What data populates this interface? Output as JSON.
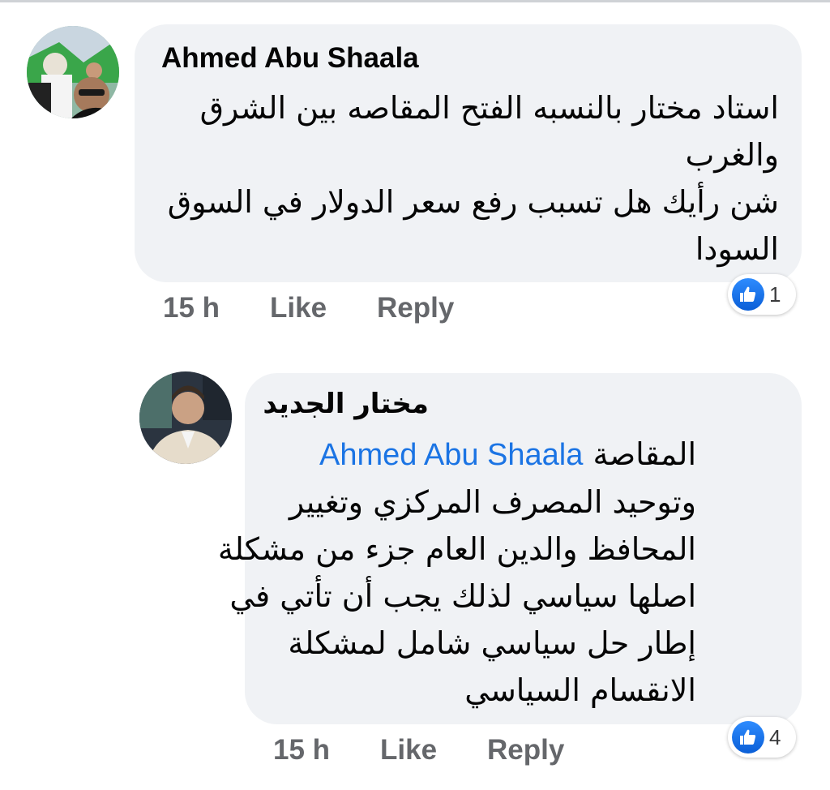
{
  "comments": [
    {
      "author": "Ahmed Abu Shaala",
      "body_lines": [
        "استاد مختار بالنسبه الفتح المقاصه بين الشرق",
        "والغرب",
        "شن رأيك هل تسبب رفع سعر الدولار في السوق",
        "السودا"
      ],
      "time": "15 h",
      "like_label": "Like",
      "reply_label": "Reply",
      "reaction_icon": "like-icon",
      "reaction_count": "1"
    },
    {
      "author": "مختار الجديد",
      "mention": "Ahmed Abu Shaala",
      "first_line_text": "المقاصة",
      "body_lines": [
        "وتوحيد المصرف المركزي وتغيير",
        "المحافظ والدين العام جزء من مشكلة",
        "اصلها سياسي لذلك يجب أن تأتي في",
        "إطار حل سياسي شامل لمشكلة",
        "الانقسام السياسي"
      ],
      "time": "15 h",
      "like_label": "Like",
      "reply_label": "Reply",
      "reaction_icon": "like-icon",
      "reaction_count": "4"
    }
  ],
  "colors": {
    "bubble": "#f0f2f5",
    "mention": "#1b74e4",
    "meta": "#65676b",
    "like_blue": "#1877f2"
  }
}
